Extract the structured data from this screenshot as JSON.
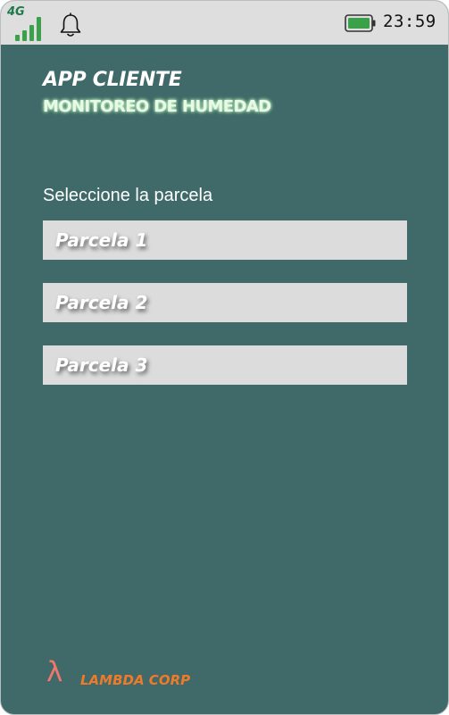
{
  "status_bar": {
    "network_label": "4G",
    "signal_icon": "signal-bars-icon",
    "notification_icon": "bell-icon",
    "battery_icon": "battery-full-icon",
    "time": "23:59"
  },
  "header": {
    "title": "APP CLIENTE",
    "subtitle": "MONITOREO DE HUMEDAD"
  },
  "main": {
    "prompt": "Seleccione la parcela",
    "plots": [
      {
        "label": "Parcela 1"
      },
      {
        "label": "Parcela 2"
      },
      {
        "label": "Parcela 3"
      }
    ]
  },
  "footer": {
    "logo_symbol": "λ",
    "brand": "LAMBDA CORP"
  },
  "colors": {
    "background": "#406a69",
    "status_bar": "#dedede",
    "button": "#dcdcdc",
    "signal": "#3aa14a",
    "brand": "#ef7b2a"
  }
}
